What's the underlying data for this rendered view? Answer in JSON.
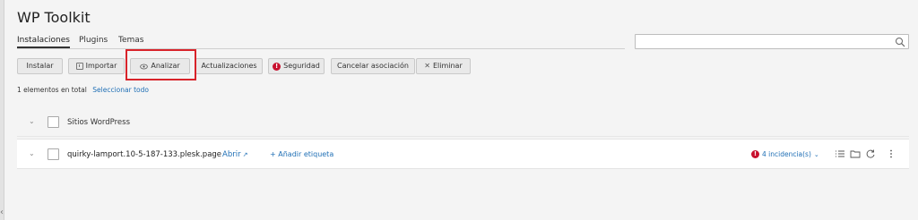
{
  "app": {
    "title": "WP Toolkit"
  },
  "tabs": [
    {
      "label": "Instalaciones",
      "active": true
    },
    {
      "label": "Plugins",
      "active": false
    },
    {
      "label": "Temas",
      "active": false
    }
  ],
  "search": {
    "value": "",
    "placeholder": ""
  },
  "toolbar": {
    "instalar": "Instalar",
    "importar": "Importar",
    "analizar": "Analizar",
    "actualizaciones": "Actualizaciones",
    "seguridad": "Seguridad",
    "cancelar": "Cancelar asociación",
    "eliminar": "Eliminar"
  },
  "summary": {
    "count_text": "1 elementos en total",
    "select_all": "Seleccionar todo"
  },
  "list": {
    "header_label": "Sitios WordPress",
    "rows": [
      {
        "name": "quirky-lamport.10-5-187-133.plesk.page",
        "open_label": "Abrir",
        "add_tag": "Añadir etiqueta",
        "issues": "4 incidencia(s)"
      }
    ]
  },
  "colors": {
    "accent": "#1f6fb5",
    "alert": "#c8102e",
    "highlight": "#d8232a"
  },
  "icons": [
    "search-icon",
    "import-icon",
    "eye-icon",
    "alert-icon",
    "close-icon",
    "external-link-icon",
    "list-icon",
    "folder-icon",
    "refresh-icon",
    "more-icon"
  ]
}
